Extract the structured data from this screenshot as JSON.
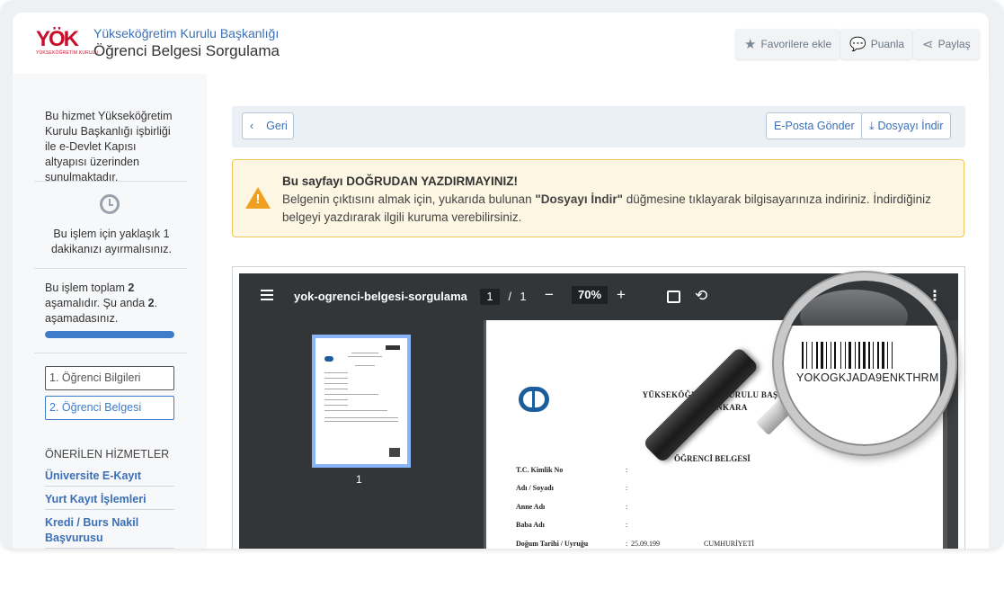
{
  "header": {
    "logo_text": "YÖK",
    "logo_subtext": "YÜKSEKÖĞRETİM KURULU",
    "org_title": "Yükseköğretim Kurulu Başkanlığı",
    "page_title": "Öğrenci Belgesi Sorgulama",
    "buttons": [
      {
        "label": "Favorilere ekle",
        "icon": "star-icon"
      },
      {
        "label": "Puanla",
        "icon": "chat-icon"
      },
      {
        "label": "Paylaş",
        "icon": "share-icon"
      }
    ]
  },
  "sidebar": {
    "info_text": "Bu hizmet Yükseköğretim Kurulu Başkanlığı işbirliği ile e-Devlet Kapısı altyapısı üzerinden sunulmaktadır.",
    "time_text": "Bu işlem için yaklaşık 1 dakikanızı ayırmalısınız.",
    "step_text_1": "Bu işlem toplam ",
    "step_total": "2",
    "step_text_2": " aşamalıdır. Şu anda ",
    "step_current": "2",
    "step_text_3": ". aşamadasınız.",
    "progress_percent": 100,
    "steps": [
      {
        "label": "1. Öğrenci Bilgileri"
      },
      {
        "label": "2. Öğrenci Belgesi"
      }
    ],
    "recommended_title": "ÖNERİLEN HİZMETLER",
    "recommended": [
      {
        "label": "Üniversite E-Kayıt"
      },
      {
        "label": "Yurt Kayıt İşlemleri"
      },
      {
        "label": "Kredi / Burs Nakil Başvurusu"
      }
    ]
  },
  "toolbar": {
    "back_label": "Geri",
    "email_label": "E-Posta Gönder",
    "download_label": "Dosyayı İndir"
  },
  "warning": {
    "title": "Bu sayfayı DOĞRUDAN YAZDIRMAYINIZ!",
    "body_1": "Belgenin çıktısını almak için, yukarıda bulunan ",
    "body_bold": "\"Dosyayı İndir\"",
    "body_2": " düğmesine tıklayarak bilgisayarınıza indiriniz. İndirdiğiniz belgeyi yazdırarak ilgili kuruma verebilirsiniz."
  },
  "pdf": {
    "filename": "yok-ogrenci-belgesi-sorgulama",
    "page_current": "1",
    "page_sep": "/",
    "page_total": "1",
    "zoom": "70%",
    "thumb_label": "1"
  },
  "document": {
    "tc": "T.C.",
    "org": "YÜKSEKÖĞRETİM KURULU BAŞKANLIĞI",
    "city": "ANKARA",
    "title": "ÖĞRENCİ BELGESİ",
    "fields": [
      {
        "label": "T.C. Kimlik No",
        "value": ""
      },
      {
        "label": "Adı / Soyadı",
        "value": ""
      },
      {
        "label": "Anne Adı",
        "value": ""
      },
      {
        "label": "Baba Adı",
        "value": ""
      },
      {
        "label": "Doğum Tarihi / Uyruğu",
        "value": "25.09.199"
      }
    ],
    "nationality_fragment": "CUMHURİYETİ"
  },
  "magnifier": {
    "barcode_text": "YOKOGKJADA9ENKTHRM"
  },
  "colors": {
    "brand_red": "#c8102e",
    "link_blue": "#3b6fb6",
    "warning_border": "#f1c75b",
    "warning_icon": "#f0a020"
  }
}
